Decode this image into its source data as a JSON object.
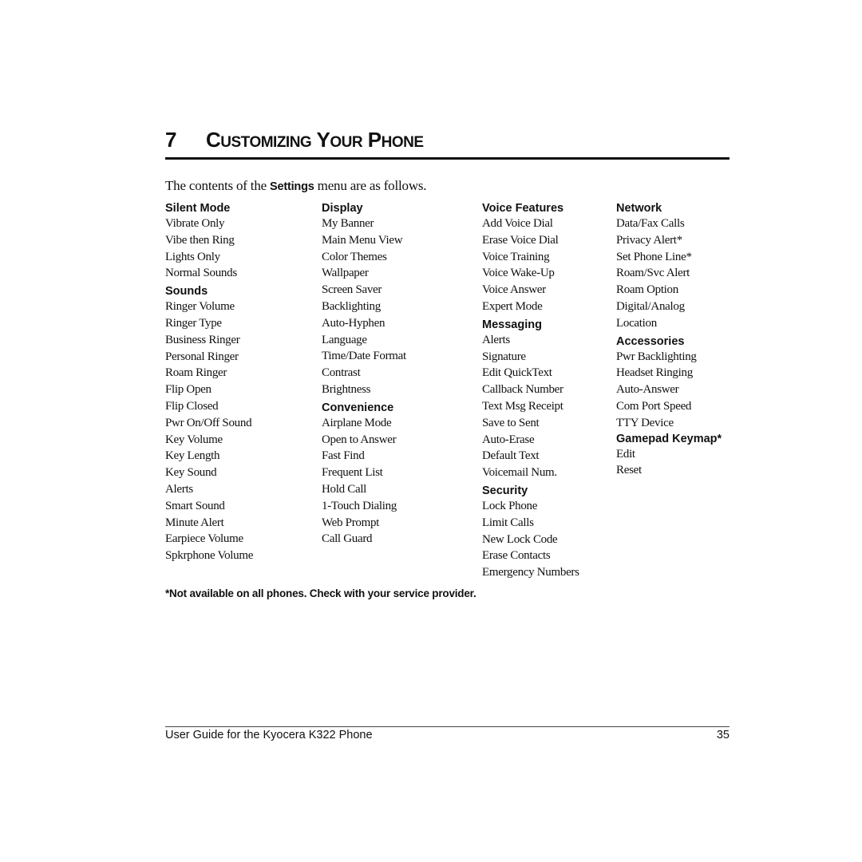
{
  "chapter": {
    "number": "7",
    "title_parts": [
      {
        "cap": "C",
        "rest": "USTOMIZING"
      },
      {
        "cap": "Y",
        "rest": "OUR"
      },
      {
        "cap": "P",
        "rest": "HONE"
      }
    ]
  },
  "intro": {
    "before": "The contents of the ",
    "bold": "Settings",
    "after": " menu are as follows."
  },
  "columns": [
    {
      "sections": [
        {
          "title": "Silent Mode",
          "items": [
            "Vibrate Only",
            "Vibe then Ring",
            "Lights Only",
            "Normal Sounds"
          ]
        },
        {
          "title": "Sounds",
          "items": [
            "Ringer Volume",
            "Ringer Type",
            "Business Ringer",
            "Personal Ringer",
            "Roam Ringer",
            "Flip Open",
            "Flip Closed",
            "Pwr On/Off Sound",
            "Key Volume",
            "Key Length",
            "Key Sound",
            "Alerts",
            "Smart Sound",
            "Minute Alert",
            "Earpiece Volume",
            "Spkrphone Volume"
          ]
        }
      ]
    },
    {
      "sections": [
        {
          "title": "Display",
          "items": [
            "My Banner",
            "Main Menu View",
            "Color Themes",
            "Wallpaper",
            "Screen Saver",
            "Backlighting",
            "Auto-Hyphen",
            "Language",
            "Time/Date Format",
            "Contrast",
            "Brightness"
          ]
        },
        {
          "title": "Convenience",
          "items": [
            "Airplane Mode",
            "Open to Answer",
            "Fast Find",
            "Frequent List",
            "Hold Call",
            "1-Touch Dialing",
            "Web Prompt",
            "Call Guard"
          ]
        }
      ]
    },
    {
      "sections": [
        {
          "title": "Voice Features",
          "items": [
            "Add Voice Dial",
            "Erase Voice Dial",
            "Voice Training",
            "Voice Wake-Up",
            "Voice Answer",
            "Expert Mode"
          ]
        },
        {
          "title": "Messaging",
          "items": [
            "Alerts",
            "Signature",
            "Edit QuickText",
            "Callback Number",
            "Text Msg Receipt",
            "Save to Sent",
            "Auto-Erase",
            "Default Text",
            "Voicemail Num."
          ]
        },
        {
          "title": "Security",
          "items": [
            "Lock Phone",
            "Limit Calls",
            "New Lock Code",
            "Erase Contacts",
            "Emergency Numbers"
          ]
        }
      ]
    },
    {
      "sections": [
        {
          "title": "Network",
          "items": [
            "Data/Fax Calls",
            "Privacy Alert*",
            "Set Phone Line*",
            "Roam/Svc Alert",
            "Roam Option",
            "Digital/Analog",
            "Location"
          ]
        },
        {
          "title": "Accessories",
          "items": [
            "Pwr Backlighting",
            "Headset Ringing",
            "Auto-Answer",
            "Com Port Speed",
            "TTY Device"
          ]
        },
        {
          "title": "Gamepad Keymap*",
          "items": [
            "Edit",
            "Reset"
          ],
          "tight": true
        }
      ]
    }
  ],
  "footnote": "*Not available on all phones. Check with your service provider.",
  "footer": {
    "left": "User Guide for the Kyocera K322 Phone",
    "page_number": "35"
  }
}
